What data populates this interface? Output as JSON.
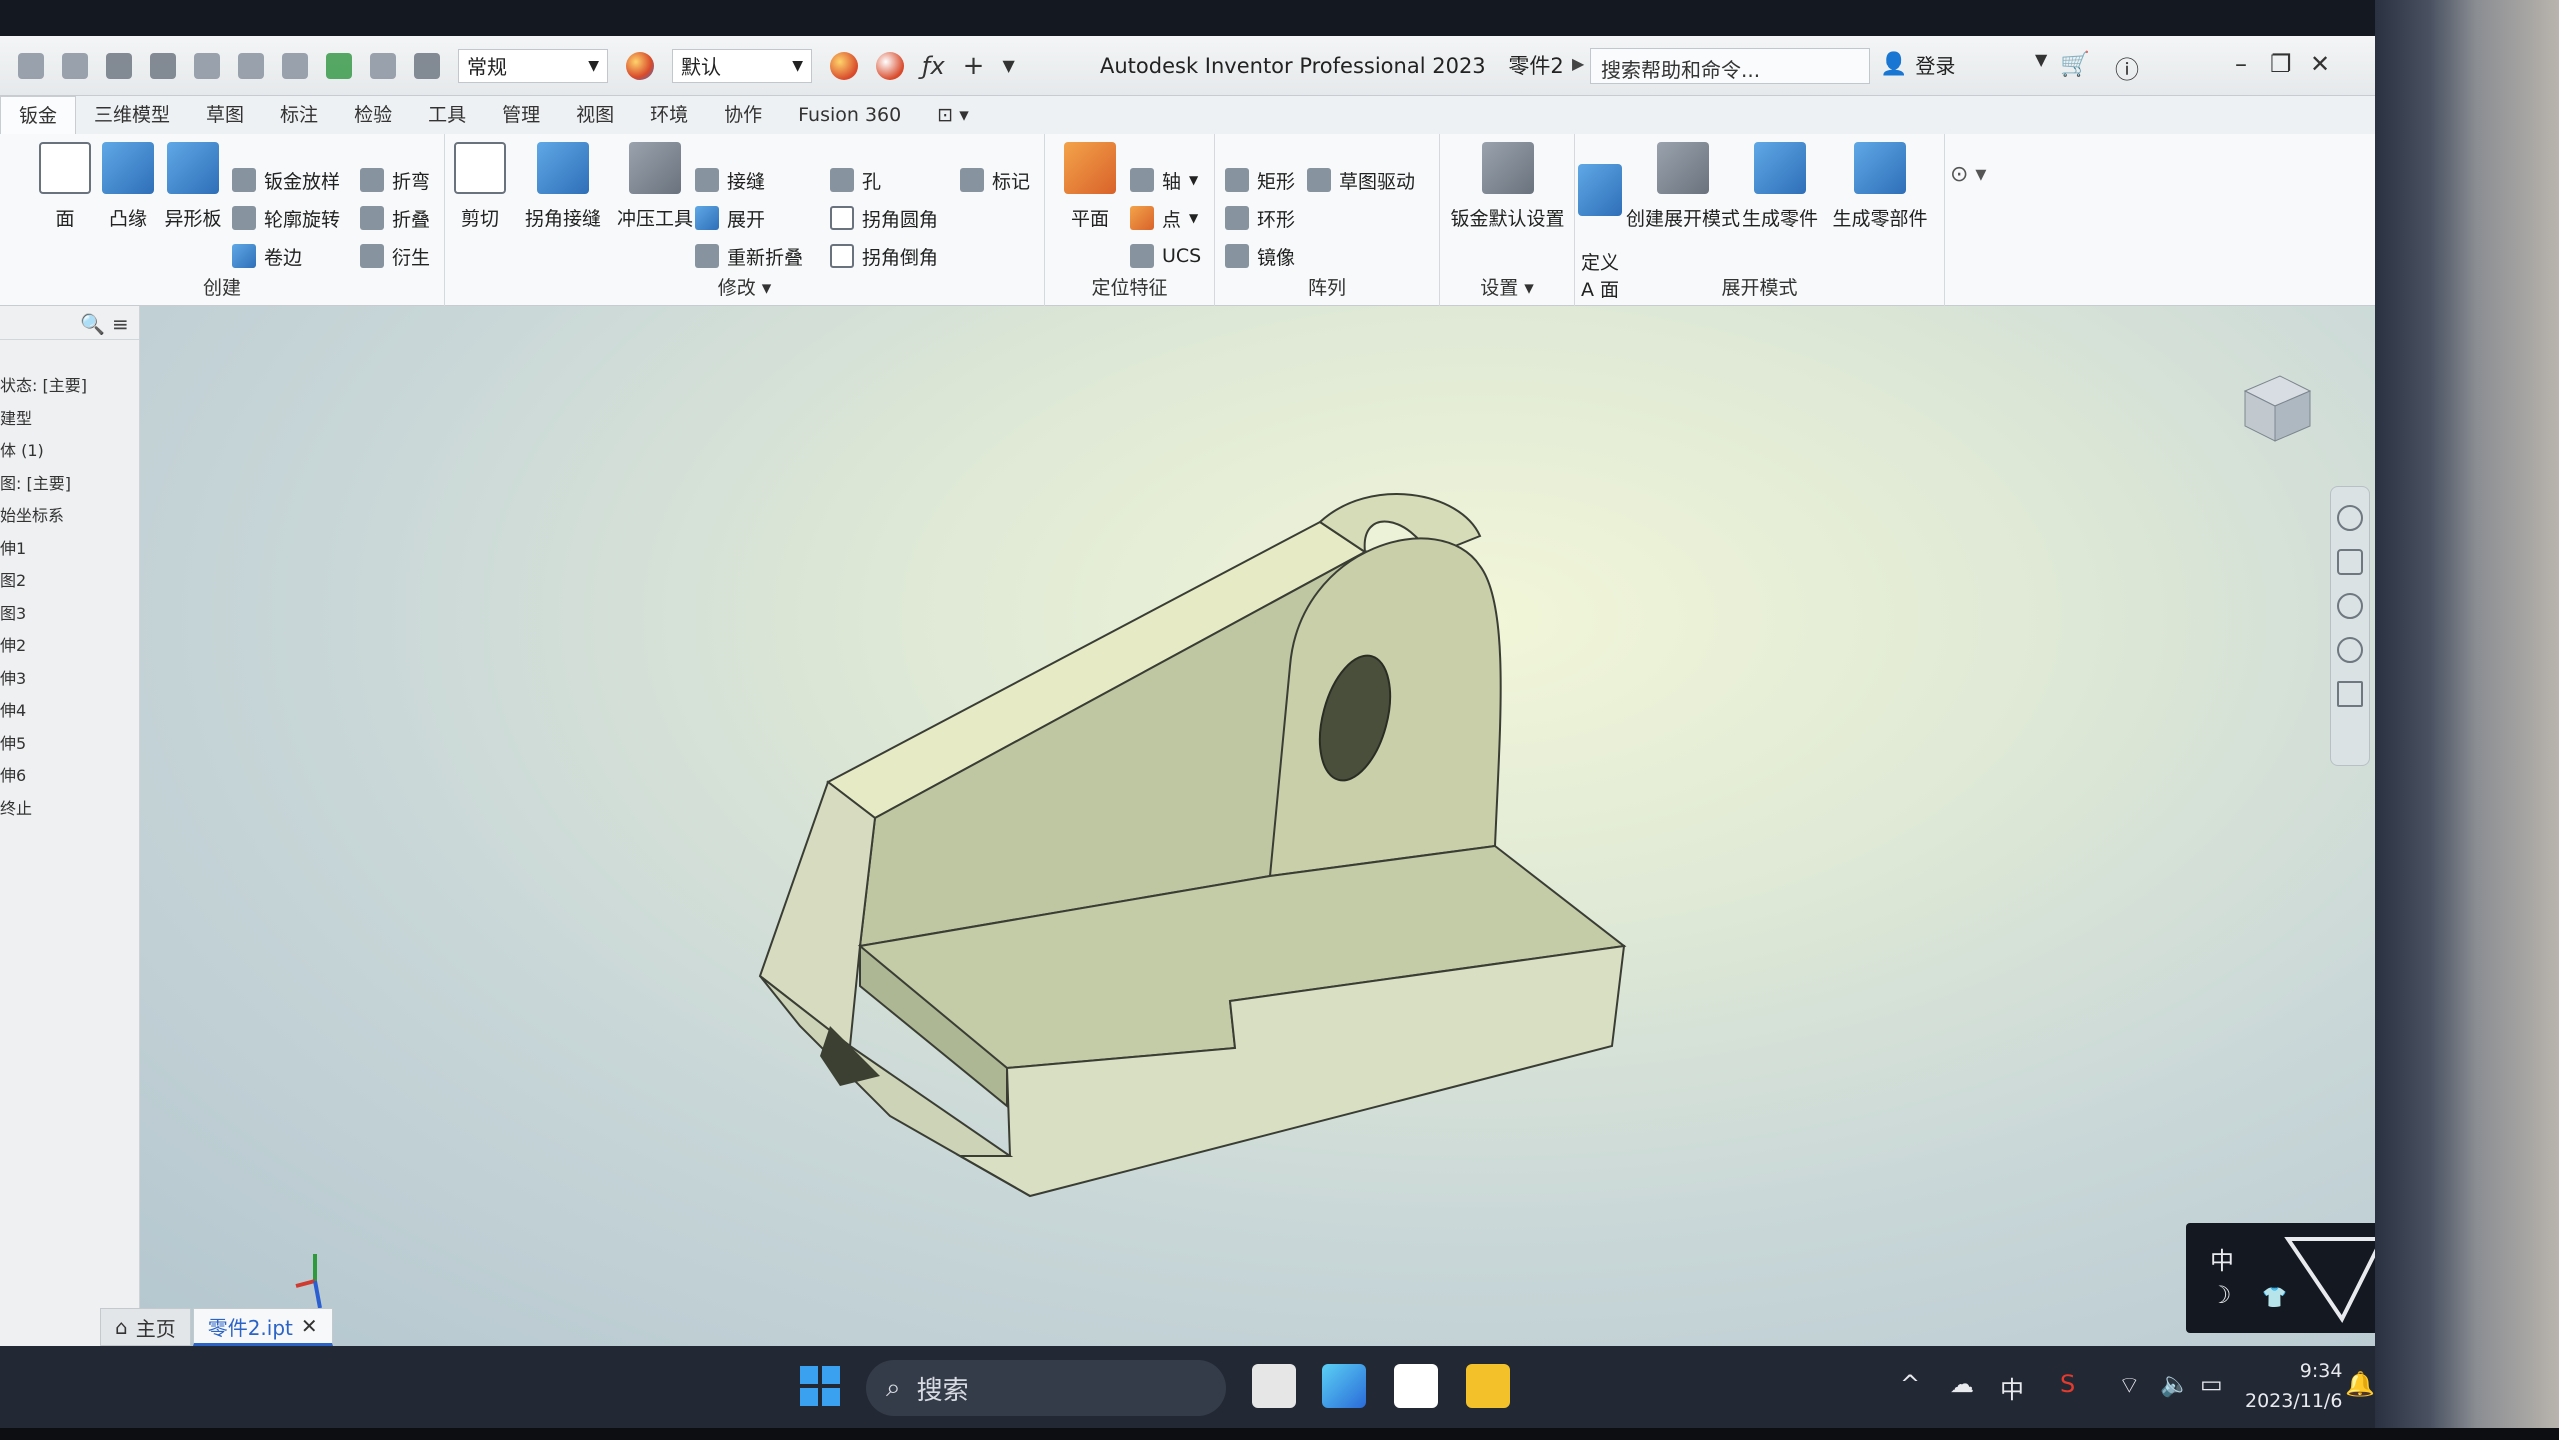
{
  "window": {
    "title": "Autodesk Inventor Professional 2023",
    "doc_name": "零件2",
    "help_search": "搜索帮助和命令...",
    "login": "登录",
    "appearance_combo": "常规",
    "material_combo": "默认"
  },
  "tabs": [
    "钣金",
    "三维模型",
    "草图",
    "标注",
    "检验",
    "工具",
    "管理",
    "视图",
    "环境",
    "协作",
    "Fusion 360"
  ],
  "ribbon": {
    "create": {
      "title": "创建",
      "big": [
        "面",
        "凸缘",
        "异形板"
      ],
      "small": [
        "钣金放样",
        "轮廓旋转",
        "卷边",
        "折弯",
        "折叠",
        "衍生"
      ]
    },
    "modify": {
      "title": "修改",
      "big": [
        "剪切",
        "拐角接缝",
        "冲压工具"
      ],
      "small": [
        "接缝",
        "展开",
        "重新折叠",
        "孔",
        "拐角圆角",
        "拐角倒角",
        "标记"
      ]
    },
    "work": {
      "title": "定位特征",
      "big": "平面",
      "small": [
        "轴",
        "点",
        "UCS"
      ]
    },
    "pattern": {
      "title": "阵列",
      "small": [
        "矩形",
        "环形",
        "镜像",
        "草图驱动"
      ]
    },
    "setup": {
      "title": "设置",
      "big": "钣金默认设置"
    },
    "flat": {
      "title": "展开模式",
      "big": [
        "定义\nA 面",
        "创建展开模式",
        "生成零件",
        "生成零部件"
      ]
    }
  },
  "browser": {
    "items": [
      "状态: [主要]",
      "建型",
      "体 (1)",
      "图: [主要]",
      "始坐标系",
      "伸1",
      "图2",
      "图3",
      "伸2",
      "伸3",
      "伸4",
      "伸5",
      "伸6",
      "终止"
    ]
  },
  "doc_tabs": {
    "home": "主页",
    "file": "零件2.ipt"
  },
  "ime": {
    "lang": "中"
  },
  "taskbar": {
    "search": "搜索",
    "ime": "中",
    "time": "9:34",
    "date": "2023/11/6"
  }
}
